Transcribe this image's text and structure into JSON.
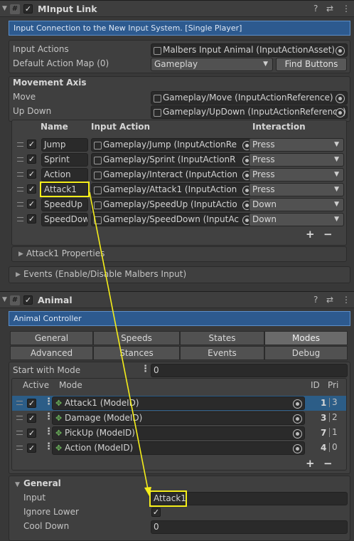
{
  "minput": {
    "title": "MInput Link",
    "info": "Input Connection to the New Input System. [Single Player]",
    "input_actions_label": "Input Actions",
    "input_actions_value": "Malbers Input Animal (InputActionAsset)",
    "default_map_label": "Default Action Map (0)",
    "default_map_value": "Gameplay",
    "find_buttons": "Find Buttons",
    "movement_axis": "Movement Axis",
    "move_label": "Move",
    "move_value": "Gameplay/Move (InputActionReference)",
    "updown_label": "Up Down",
    "updown_value": "Gameplay/UpDown (InputActionReference)",
    "col_name": "Name",
    "col_action": "Input Action",
    "col_interaction": "Interaction",
    "rows": [
      {
        "name": "Jump",
        "action": "Gameplay/Jump (InputActionRe",
        "interaction": "Press"
      },
      {
        "name": "Sprint",
        "action": "Gameplay/Sprint (InputActionR",
        "interaction": "Press"
      },
      {
        "name": "Action",
        "action": "Gameplay/Interact (InputAction",
        "interaction": "Press"
      },
      {
        "name": "Attack1",
        "action": "Gameplay/Attack1 (InputAction",
        "interaction": "Press"
      },
      {
        "name": "SpeedUp",
        "action": "Gameplay/SpeedUp (InputActio",
        "interaction": "Down"
      },
      {
        "name": "SpeedDow",
        "action": "Gameplay/SpeedDown (InputAc",
        "interaction": "Down"
      }
    ],
    "plus": "+",
    "minus": "−",
    "attack_props": "Attack1 Properties",
    "events": "Events (Enable/Disable Malbers Input)"
  },
  "animal": {
    "title": "Animal",
    "info": "Animal Controller",
    "tabs_row1": [
      "General",
      "Speeds",
      "States",
      "Modes"
    ],
    "tabs_row2": [
      "Advanced",
      "Stances",
      "Events",
      "Debug"
    ],
    "start_mode_label": "Start with Mode",
    "start_mode_value": "0",
    "col_active": "Active",
    "col_mode": "Mode",
    "col_id": "ID",
    "col_pri": "Pri",
    "modes": [
      {
        "mode": "Attack1 (ModeID)",
        "id": "1",
        "pri": "3"
      },
      {
        "mode": "Damage (ModeID)",
        "id": "3",
        "pri": "2"
      },
      {
        "mode": "PickUp (ModeID)",
        "id": "7",
        "pri": "1"
      },
      {
        "mode": "Action (ModeID)",
        "id": "4",
        "pri": "0"
      }
    ],
    "plus": "+",
    "minus": "−",
    "general": "General",
    "input_label": "Input",
    "input_value": "Attack1",
    "ignore_lower_label": "Ignore Lower",
    "cooldown_label": "Cool Down",
    "cooldown_value": "0"
  },
  "icons": {
    "hash": "#",
    "check": "✓",
    "fold_open": "▼",
    "fold_closed": "▶",
    "help": "?",
    "settings": "⇄",
    "menu": "⋮",
    "dropdown": "▼",
    "dots": "⋮",
    "mode": "✥"
  },
  "colors": {
    "highlight": "#f5ee1a",
    "info_bg": "#2d5a8f",
    "row_selected": "#2c5d87"
  }
}
